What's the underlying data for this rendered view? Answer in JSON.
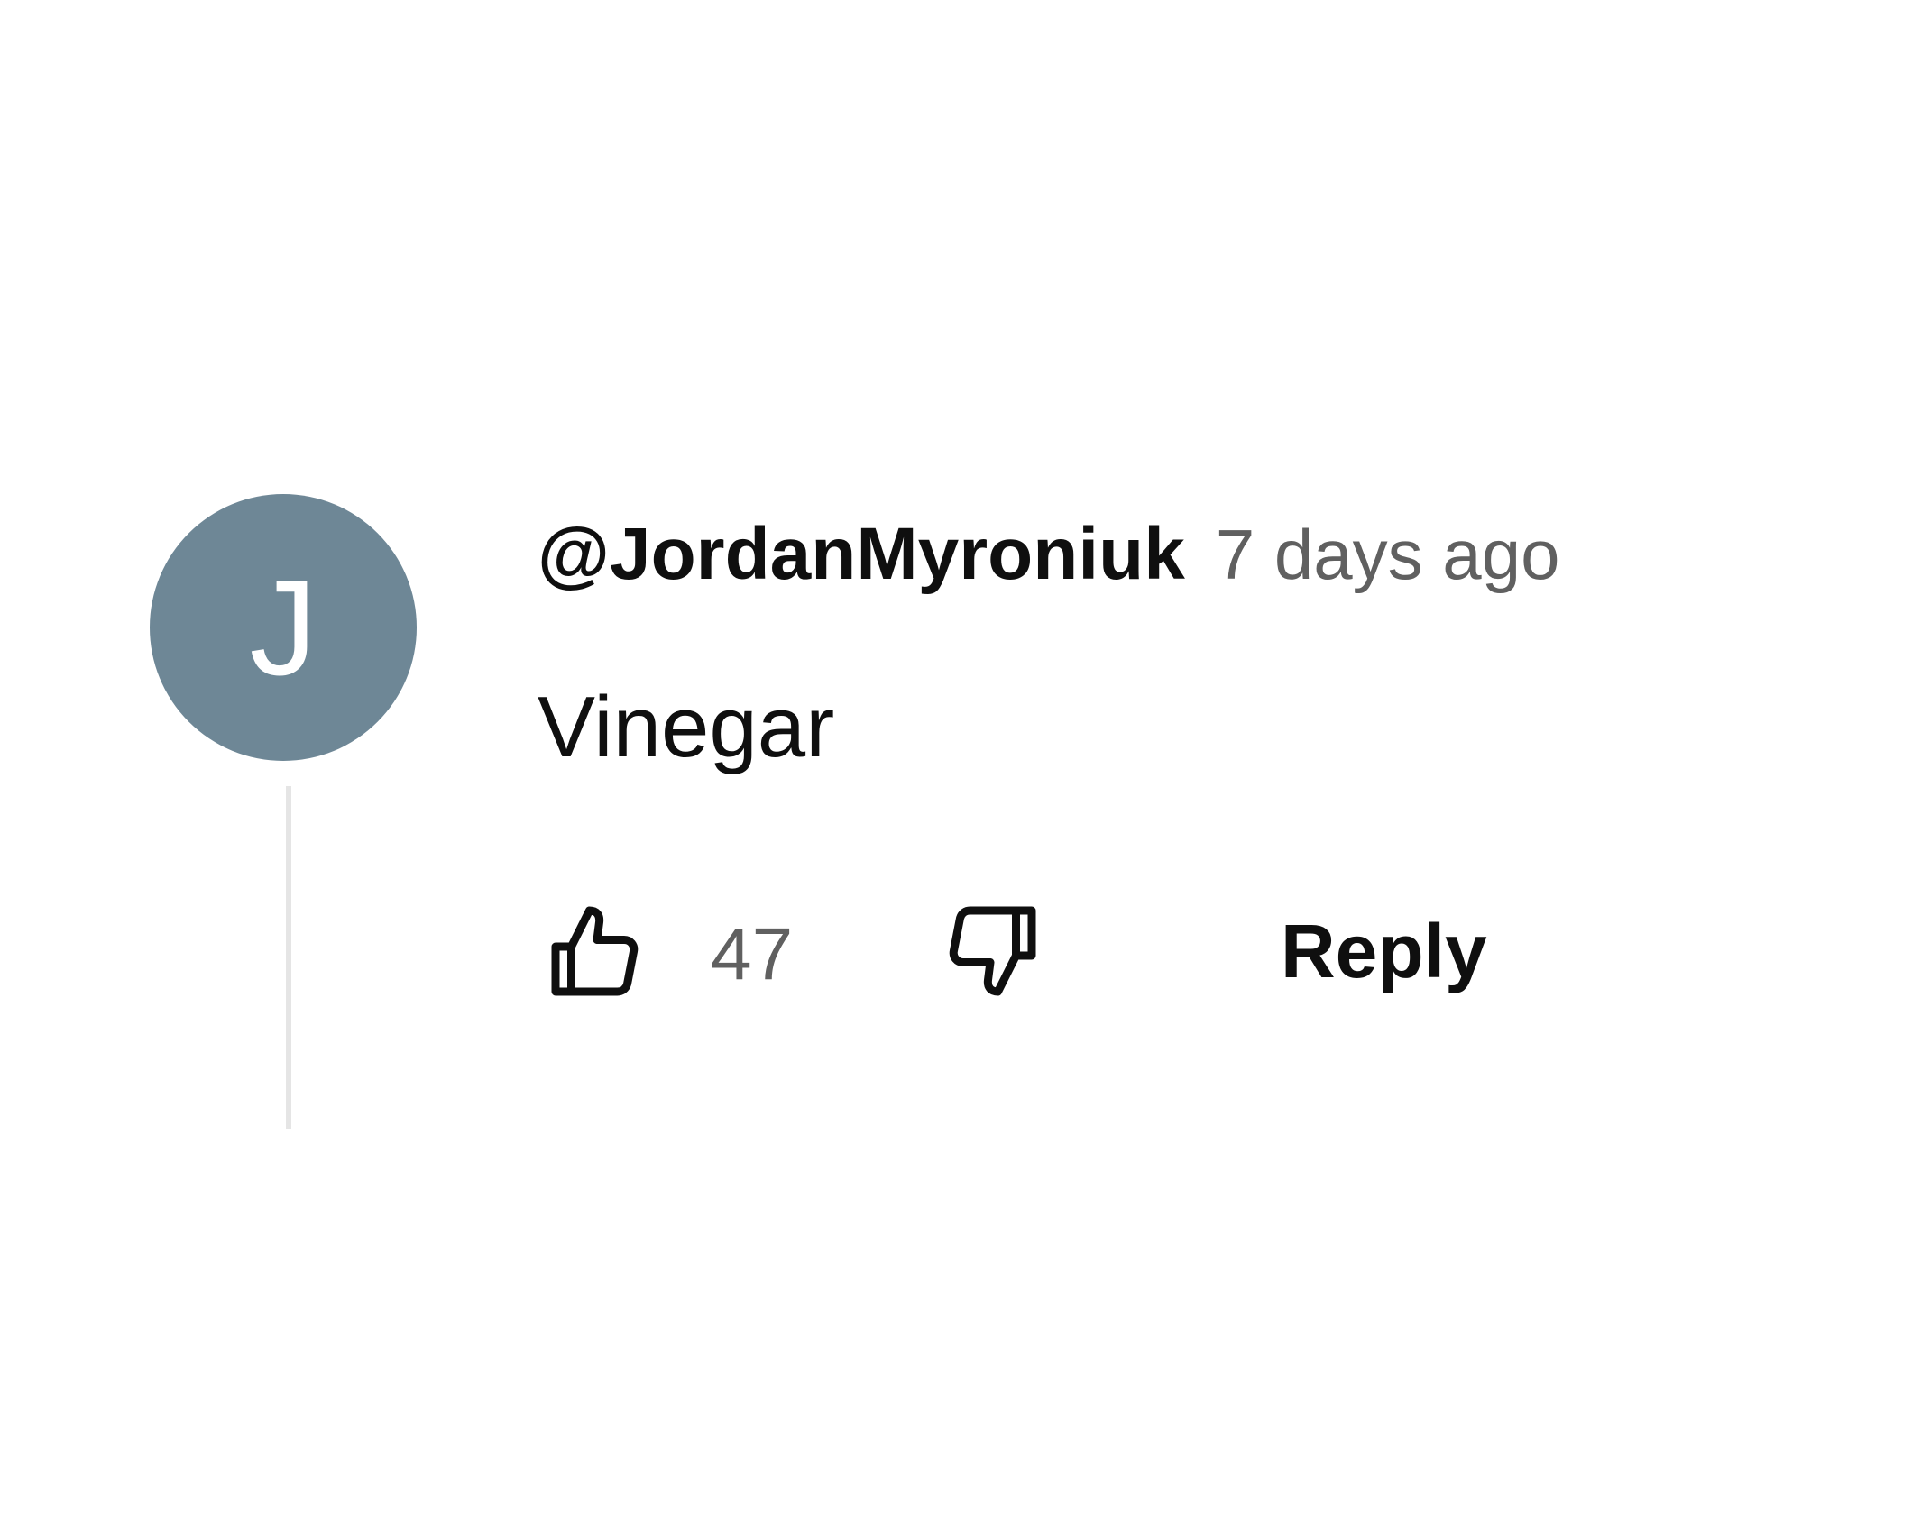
{
  "comment": {
    "avatar_initial": "J",
    "avatar_color": "#6e8796",
    "author": "@JordanMyroniuk",
    "timestamp": "7 days ago",
    "text": "Vinegar",
    "like_count": "47",
    "reply_label": "Reply",
    "like_icon": "thumbs-up-icon",
    "dislike_icon": "thumbs-down-icon"
  }
}
